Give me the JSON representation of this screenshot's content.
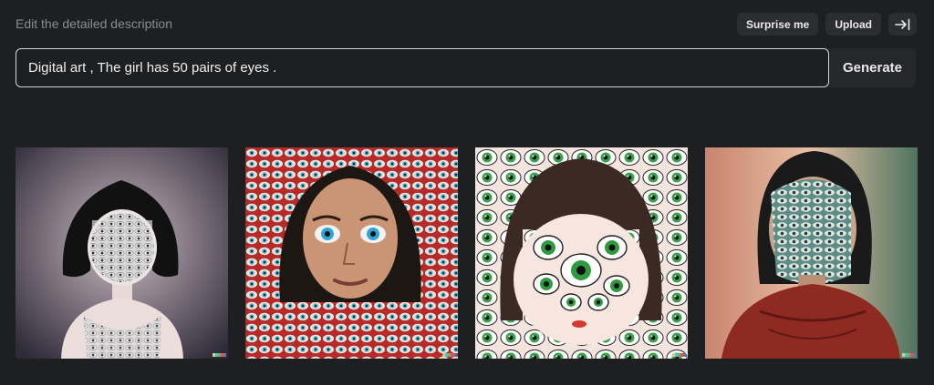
{
  "header": {
    "hint": "Edit the detailed description",
    "surprise_label": "Surprise me",
    "upload_label": "Upload",
    "collapse_icon": "collapse-right-icon"
  },
  "prompt": {
    "value": "Digital art , The girl has 50 pairs of eyes .",
    "generate_label": "Generate"
  },
  "results": [
    {
      "name": "result-image-1"
    },
    {
      "name": "result-image-2"
    },
    {
      "name": "result-image-3"
    },
    {
      "name": "result-image-4"
    }
  ],
  "colors": {
    "background": "#1e1f21",
    "button": "#2c2d30",
    "input_border": "#d3d4d6",
    "signature": [
      "#f2ce3a",
      "#47c2d9",
      "#5dbe5a",
      "#e7543f",
      "#5076d6"
    ]
  }
}
